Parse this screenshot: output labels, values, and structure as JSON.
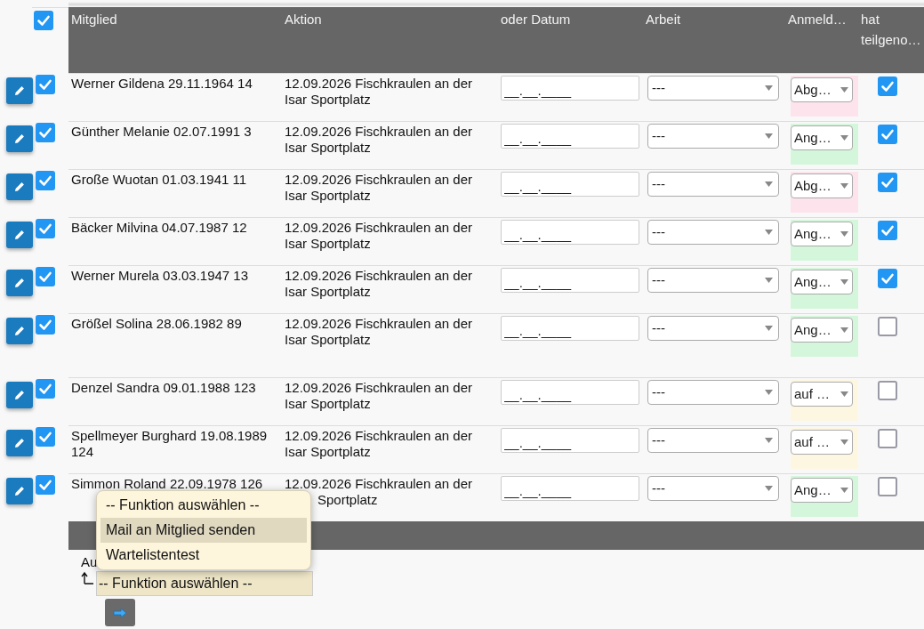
{
  "select_all": {
    "checked": true
  },
  "table": {
    "columns": [
      "Mitglied",
      "Aktion",
      "oder Datum",
      "Arbeit",
      "Anmeld…",
      "hat teilgeno…"
    ],
    "rows": [
      {
        "selected": true,
        "member": "Werner Gildena 29.11.1964 14",
        "action": "12.09.2026 Fischkraulen an der Isar Sportplatz",
        "date": "__.__.____",
        "work": "---",
        "registration": {
          "value": "Abg…",
          "color": "#fde4ec"
        },
        "attended": true
      },
      {
        "selected": true,
        "member": "Günther Melanie 02.07.1991 3",
        "action": "12.09.2026 Fischkraulen an der Isar Sportplatz",
        "date": "__.__.____",
        "work": "---",
        "registration": {
          "value": "Ang…",
          "color": "#d4f7dc"
        },
        "attended": true
      },
      {
        "selected": true,
        "member": "Große Wuotan 01.03.1941 11",
        "action": "12.09.2026 Fischkraulen an der Isar Sportplatz",
        "date": "__.__.____",
        "work": "---",
        "registration": {
          "value": "Abg…",
          "color": "#fde4ec"
        },
        "attended": true
      },
      {
        "selected": true,
        "member": "Bäcker Milvina 04.07.1987 12",
        "action": "12.09.2026 Fischkraulen an der Isar Sportplatz",
        "date": "__.__.____",
        "work": "---",
        "registration": {
          "value": "Ang…",
          "color": "#d4f7dc"
        },
        "attended": true
      },
      {
        "selected": true,
        "member": "Werner Murela 03.03.1947 13",
        "action": "12.09.2026 Fischkraulen an der Isar Sportplatz",
        "date": "__.__.____",
        "work": "---",
        "registration": {
          "value": "Ang…",
          "color": "#d4f7dc"
        },
        "attended": true
      },
      {
        "selected": true,
        "member": "Größel Solina 28.06.1982 89",
        "action": "12.09.2026 Fischkraulen an der Isar Sportplatz",
        "date": "__.__.____",
        "work": "---",
        "registration": {
          "value": "Ang…",
          "color": "#d4f7dc"
        },
        "attended": false
      },
      {
        "selected": true,
        "member": "Denzel Sandra 09.01.1988 123",
        "action": "12.09.2026 Fischkraulen an der Isar Sportplatz",
        "date": "__.__.____",
        "work": "---",
        "registration": {
          "value": "auf …",
          "color": "#fdf7e2"
        },
        "attended": false
      },
      {
        "selected": true,
        "member": "Spellmeyer Burghard 19.08.1989 124",
        "action": "12.09.2026 Fischkraulen an der Isar Sportplatz",
        "date": "__.__.____",
        "work": "---",
        "registration": {
          "value": "auf …",
          "color": "#fdf7e2"
        },
        "attended": false
      },
      {
        "selected": true,
        "member": "Simmon Roland 22.09.1978 126",
        "action": "12.09.2026 Fischkraulen an der Sportplatz",
        "date": "__.__.____",
        "work": "---",
        "registration": {
          "value": "Ang…",
          "color": "#d4f7dc"
        },
        "attended": false
      }
    ]
  },
  "bulk_action": {
    "label": "Au",
    "select": "-- Funktion auswählen --"
  },
  "function_menu": {
    "options": [
      {
        "label": "-- Funktion auswählen --",
        "selected": false
      },
      {
        "label": "Mail an Mitglied senden",
        "selected": true
      },
      {
        "label": "Wartelistentest",
        "selected": false
      }
    ]
  }
}
